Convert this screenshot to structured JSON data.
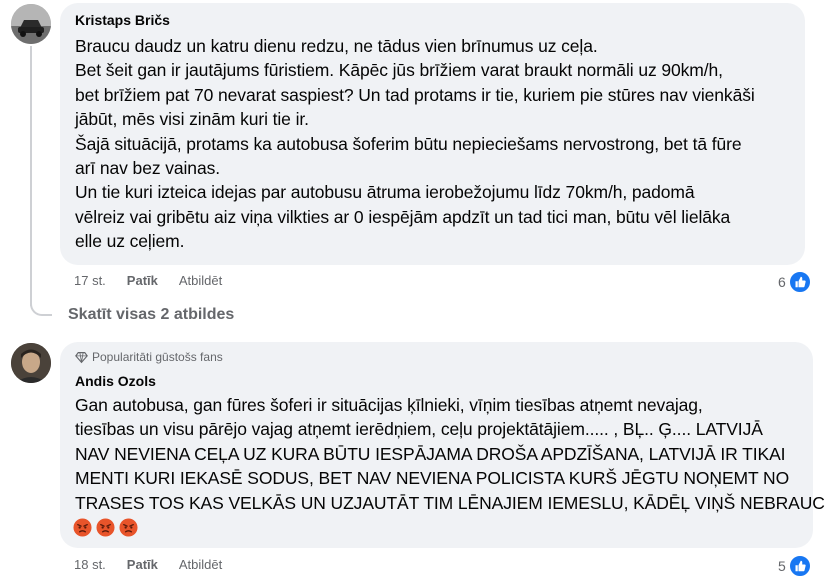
{
  "comments": [
    {
      "author": "Kristaps Bričs",
      "lines": [
        "Braucu daudz un katru dienu redzu, ne tādus vien brīnumus uz ceļa.",
        "Bet šeit gan ir jautājums fūristiem. Kāpēc jūs brīžiem varat braukt normāli uz 90km/h,",
        "bet brīžiem pat 70 nevarat saspiest? Un tad protams ir tie, kuriem pie stūres nav vienkāši",
        "jābūt, mēs visi zinām kuri tie ir.",
        "Šajā situācijā, protams ka autobusa šoferim būtu nepieciešams nervostrong, bet tā fūre",
        "arī nav bez vainas.",
        "Un tie kuri izteica idejas par autobusu ātruma ierobežojumu līdz 70km/h, padomā",
        "vēlreiz vai gribētu aiz viņa vilkties ar 0 iespējām apdzīt un tad tici man, būtu vēl lielāka",
        "elle uz ceļiem."
      ],
      "time": "17 st.",
      "like": "Patīk",
      "reply": "Atbildēt",
      "like_count": "6"
    },
    {
      "badge": "Popularitāti gūstošs fans",
      "author": "Andis Ozols",
      "lines": [
        "Gan autobusa, gan fūres šoferi ir situācijas ķīlnieki, vīņim tiesības atņemt nevajag,",
        "tiesības un visu pārējo vajag atņemt ierēdņiem, ceļu projektātājiem..... , BĻ.. Ģ.... LATVIJĀ",
        "NAV NEVIENA CEĻA UZ KURA BŪTU IESPĀJAMA DROŠA APDZĪŠANA, LATVIJĀ IR TIKAI",
        "MENTI KURI IEKASĒ SODUS, BET NAV NEVIENA POLICISTA KURŠ JĒGTU NOŅEMT NO",
        "TRASES TOS KAS VELKĀS UN UZJAUTĀT TIM LĒNAJIEM IEMESLU, KĀDĒĻ VIŅŠ NEBRAUC"
      ],
      "emojis": [
        "angry-face",
        "angry-face",
        "angry-face"
      ],
      "time": "18 st.",
      "like": "Patīk",
      "reply": "Atbildēt",
      "like_count": "5"
    }
  ],
  "view_replies": "Skatīt visas 2 atbildes",
  "colors": {
    "bubble": "#f0f2f5",
    "secondary_text": "#65676b",
    "like_blue": "#1877f2",
    "thread_line": "#ced0d4"
  }
}
